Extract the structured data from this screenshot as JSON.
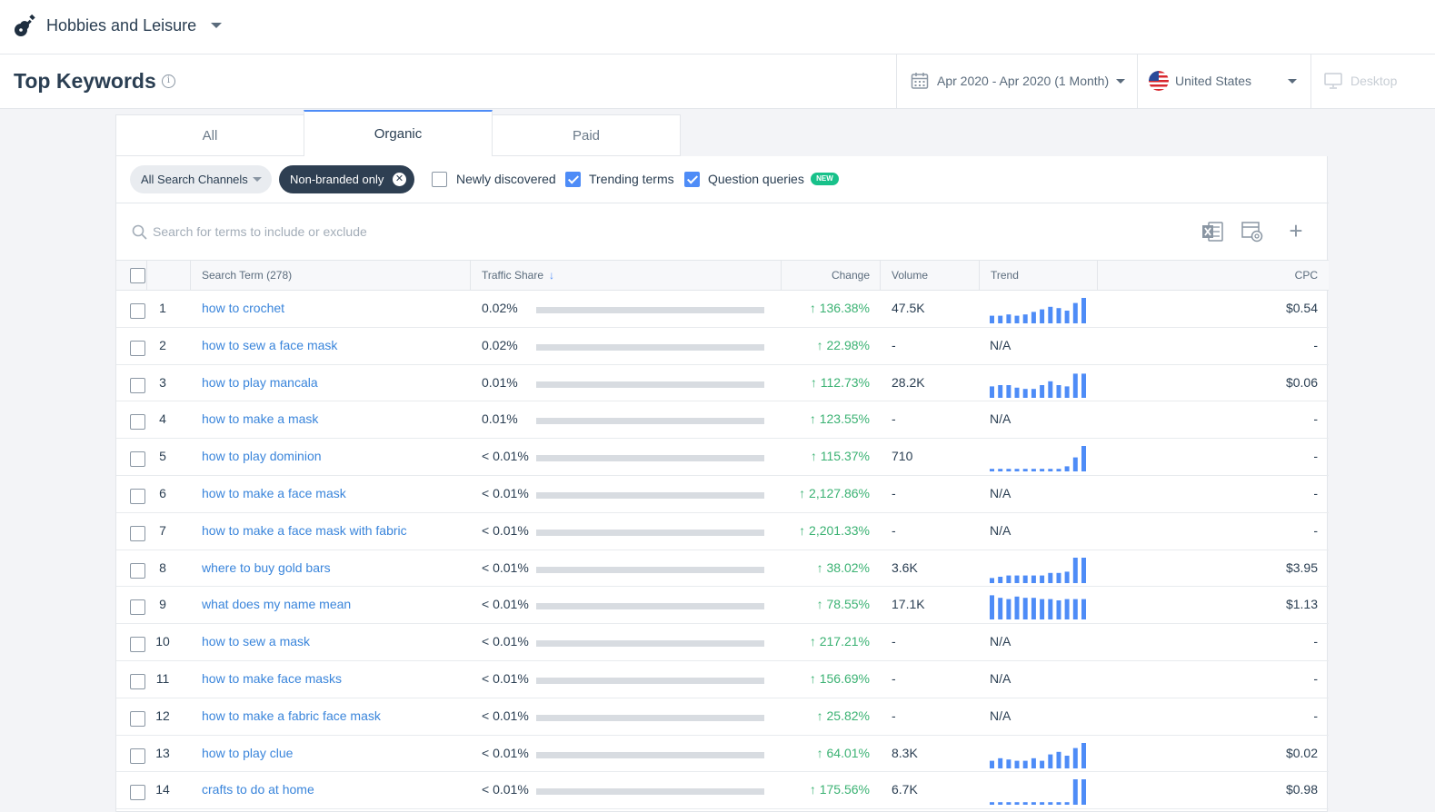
{
  "category": {
    "title": "Hobbies and Leisure",
    "icon": "guitar-icon"
  },
  "header": {
    "title": "Top Keywords",
    "date_range": "Apr 2020 - Apr 2020 (1 Month)",
    "country": "United States",
    "device": "Desktop"
  },
  "tabs": [
    {
      "label": "All",
      "active": false
    },
    {
      "label": "Organic",
      "active": true
    },
    {
      "label": "Paid",
      "active": false
    }
  ],
  "filters": {
    "channels": "All Search Channels",
    "nonbranded": "Non-branded only",
    "newly_discovered": {
      "label": "Newly discovered",
      "checked": false
    },
    "trending_terms": {
      "label": "Trending terms",
      "checked": true
    },
    "question_queries": {
      "label": "Question queries",
      "checked": true
    },
    "new_badge": "NEW"
  },
  "search": {
    "placeholder": "Search for terms to include or exclude"
  },
  "columns": {
    "search_term": "Search Term (278)",
    "traffic_share": "Traffic Share",
    "change": "Change",
    "volume": "Volume",
    "trend": "Trend",
    "cpc": "CPC"
  },
  "colors": {
    "accent": "#4e8cf7",
    "link": "#3a85db",
    "positive": "#3bb273",
    "dark": "#2e3f52"
  },
  "rows": [
    {
      "num": "1",
      "term": "how to crochet",
      "share": "0.02%",
      "change": "136.38%",
      "volume": "47.5K",
      "trend": [
        0.3,
        0.3,
        0.35,
        0.3,
        0.35,
        0.45,
        0.55,
        0.65,
        0.6,
        0.5,
        0.8,
        1.0
      ],
      "cpc": "$0.54"
    },
    {
      "num": "2",
      "term": "how to sew a face mask",
      "share": "0.02%",
      "change": "22.98%",
      "volume": "-",
      "trend": null,
      "trend_na": "N/A",
      "cpc": "-"
    },
    {
      "num": "3",
      "term": "how to play mancala",
      "share": "0.01%",
      "change": "112.73%",
      "volume": "28.2K",
      "trend": [
        0.45,
        0.5,
        0.5,
        0.4,
        0.35,
        0.35,
        0.5,
        0.65,
        0.5,
        0.45,
        0.95,
        0.95
      ],
      "cpc": "$0.06"
    },
    {
      "num": "4",
      "term": "how to make a mask",
      "share": "0.01%",
      "change": "123.55%",
      "volume": "-",
      "trend": null,
      "trend_na": "N/A",
      "cpc": "-"
    },
    {
      "num": "5",
      "term": "how to play dominion",
      "share": "< 0.01%",
      "change": "115.37%",
      "volume": "710",
      "trend": [
        0.1,
        0.1,
        0.1,
        0.1,
        0.1,
        0.1,
        0.1,
        0.1,
        0.1,
        0.2,
        0.55,
        1.0
      ],
      "cpc": "-"
    },
    {
      "num": "6",
      "term": "how to make a face mask",
      "share": "< 0.01%",
      "change": "2,127.86%",
      "volume": "-",
      "trend": null,
      "trend_na": "N/A",
      "cpc": "-"
    },
    {
      "num": "7",
      "term": "how to make a face mask with fabric",
      "share": "< 0.01%",
      "change": "2,201.33%",
      "volume": "-",
      "trend": null,
      "trend_na": "N/A",
      "cpc": "-"
    },
    {
      "num": "8",
      "term": "where to buy gold bars",
      "share": "< 0.01%",
      "change": "38.02%",
      "volume": "3.6K",
      "trend": [
        0.2,
        0.25,
        0.3,
        0.3,
        0.3,
        0.3,
        0.3,
        0.4,
        0.4,
        0.45,
        1.0,
        1.0
      ],
      "cpc": "$3.95"
    },
    {
      "num": "9",
      "term": "what does my name mean",
      "share": "< 0.01%",
      "change": "78.55%",
      "volume": "17.1K",
      "trend": [
        0.95,
        0.85,
        0.8,
        0.9,
        0.85,
        0.85,
        0.8,
        0.8,
        0.75,
        0.8,
        0.8,
        0.8
      ],
      "cpc": "$1.13"
    },
    {
      "num": "10",
      "term": "how to sew a mask",
      "share": "< 0.01%",
      "change": "217.21%",
      "volume": "-",
      "trend": null,
      "trend_na": "N/A",
      "cpc": "-"
    },
    {
      "num": "11",
      "term": "how to make face masks",
      "share": "< 0.01%",
      "change": "156.69%",
      "volume": "-",
      "trend": null,
      "trend_na": "N/A",
      "cpc": "-"
    },
    {
      "num": "12",
      "term": "how to make a fabric face mask",
      "share": "< 0.01%",
      "change": "25.82%",
      "volume": "-",
      "trend": null,
      "trend_na": "N/A",
      "cpc": "-"
    },
    {
      "num": "13",
      "term": "how to play clue",
      "share": "< 0.01%",
      "change": "64.01%",
      "volume": "8.3K",
      "trend": [
        0.3,
        0.4,
        0.35,
        0.3,
        0.3,
        0.4,
        0.3,
        0.55,
        0.65,
        0.5,
        0.8,
        1.0
      ],
      "cpc": "$0.02"
    },
    {
      "num": "14",
      "term": "crafts to do at home",
      "share": "< 0.01%",
      "change": "175.56%",
      "volume": "6.7K",
      "trend": [
        0.1,
        0.1,
        0.1,
        0.1,
        0.1,
        0.1,
        0.1,
        0.1,
        0.1,
        0.1,
        1.0,
        1.0
      ],
      "cpc": "$0.98"
    }
  ]
}
